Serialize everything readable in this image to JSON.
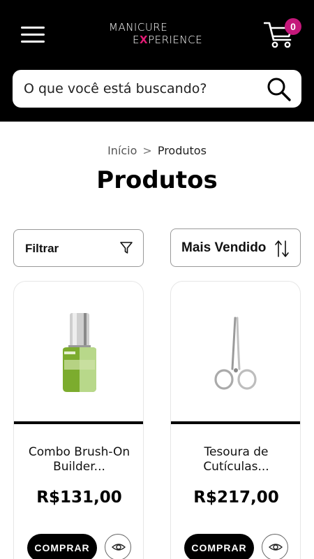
{
  "header": {
    "logo_line1": "MANICURE",
    "logo_ex": "E",
    "logo_x": "X",
    "logo_rest": "PERIENCE",
    "cart_count": "0",
    "brand_color": "#c4187a",
    "menu_icon": "hamburger-icon",
    "cart_icon": "cart-icon"
  },
  "search": {
    "placeholder": "O que você está buscando?",
    "icon": "search-icon"
  },
  "breadcrumb": {
    "home": "Início",
    "separator": ">",
    "current": "Produtos"
  },
  "page_title": "Produtos",
  "toolbar": {
    "filter_label": "Filtrar",
    "filter_icon": "funnel-icon",
    "sort_label": "Mais Vendido",
    "sort_icon": "sort-arrows-icon"
  },
  "products": [
    {
      "name": "Combo Brush-On Builder...",
      "price": "R$131,00",
      "buy_label": "COMPRAR",
      "image": "nail-polish-bottle",
      "view_icon": "eye-icon"
    },
    {
      "name": "Tesoura de Cutículas...",
      "price": "R$217,00",
      "buy_label": "COMPRAR",
      "image": "cuticle-scissors",
      "view_icon": "eye-icon"
    }
  ]
}
